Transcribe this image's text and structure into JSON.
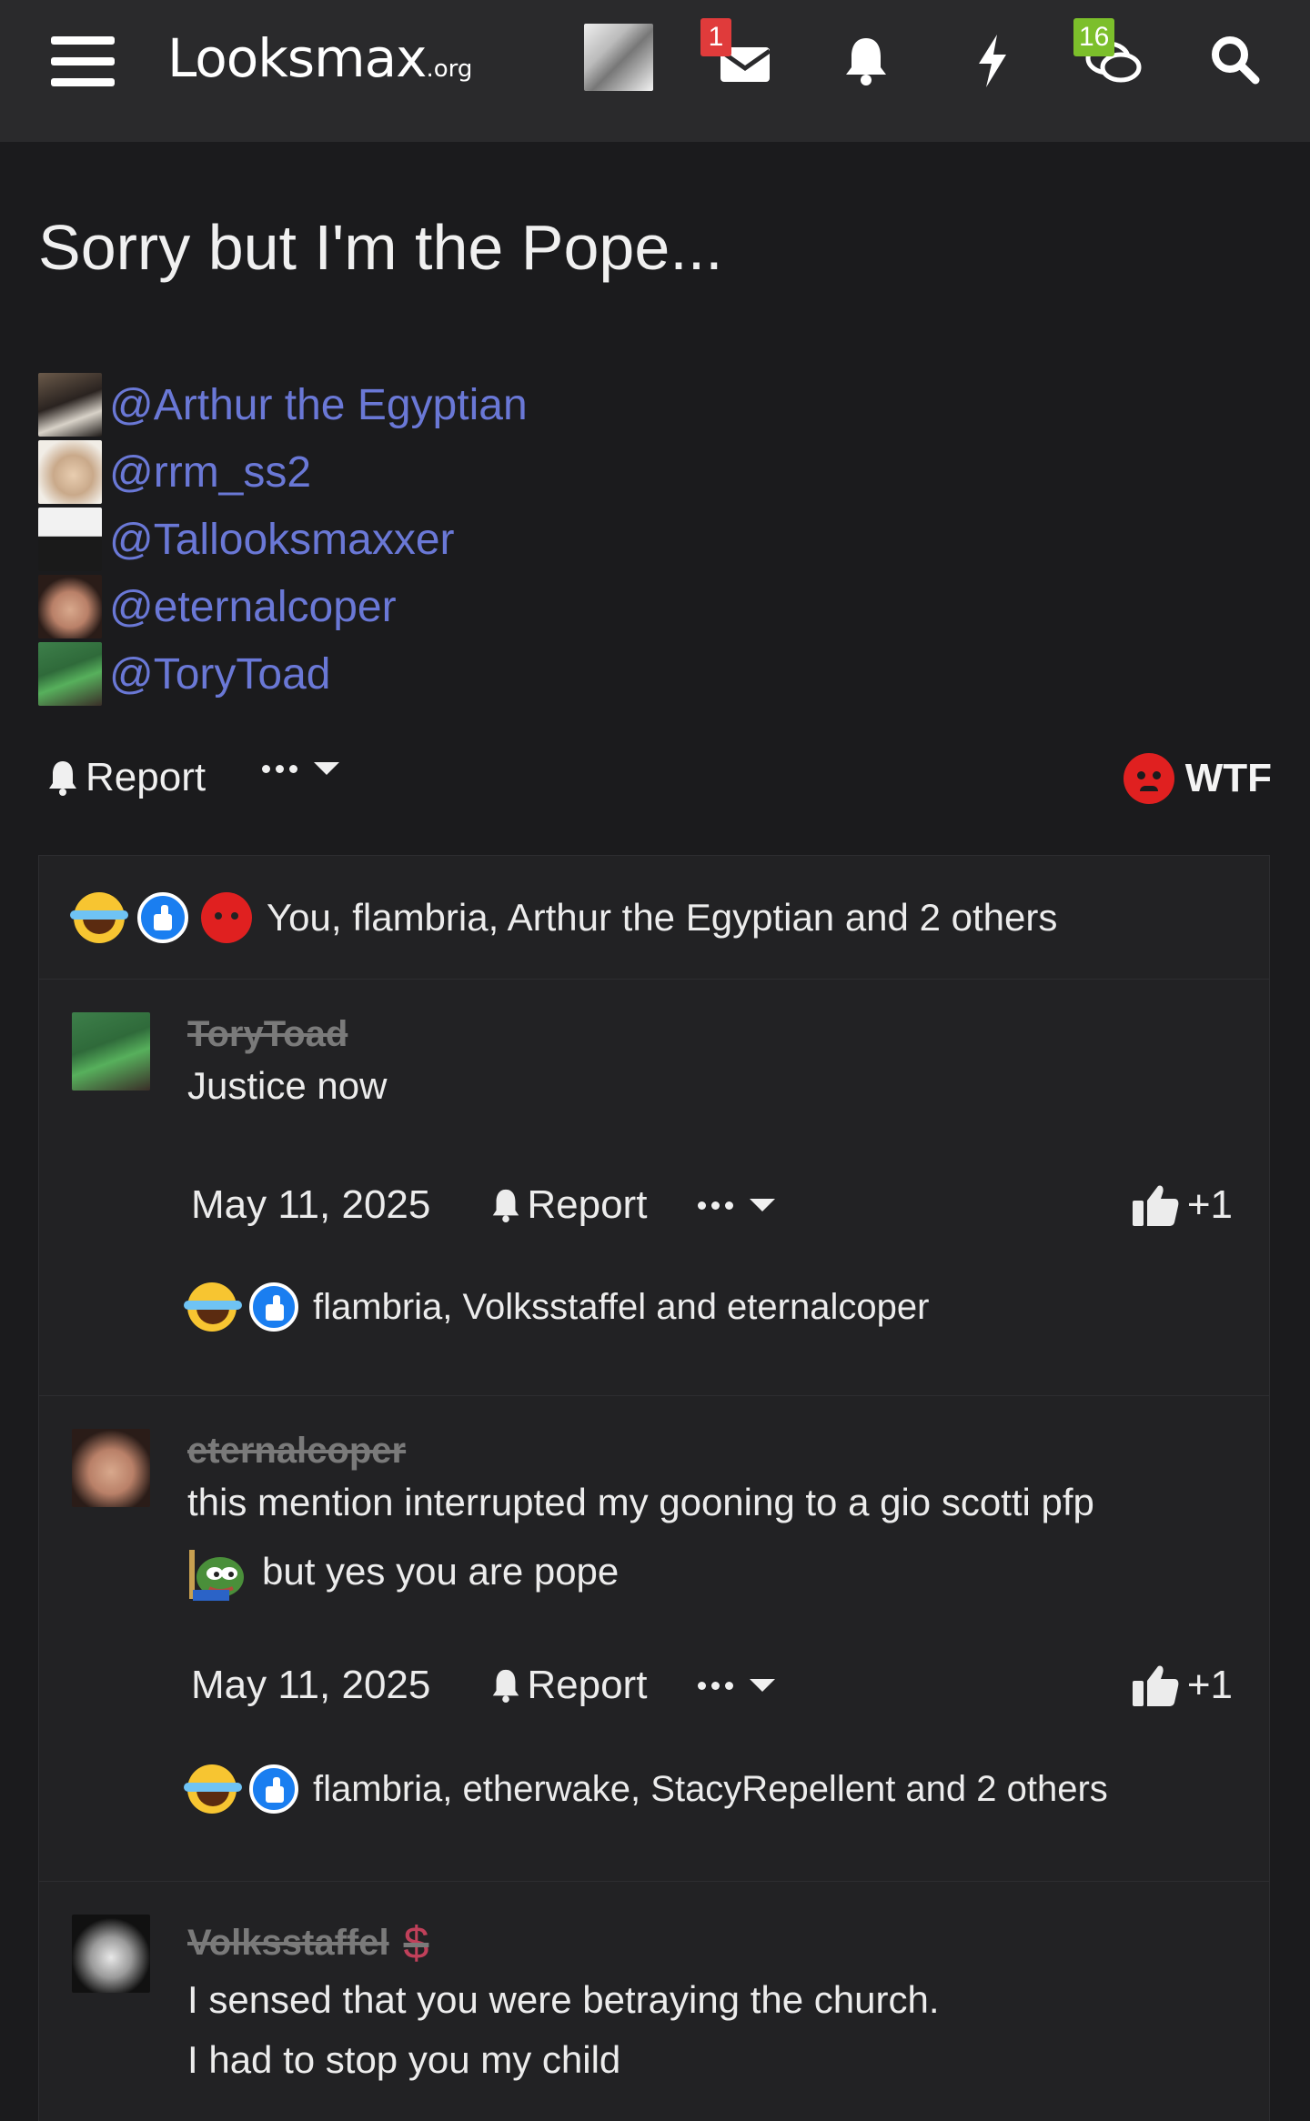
{
  "topbar": {
    "logo_main": "Looksmax",
    "logo_suffix": ".org",
    "inbox_badge": "1",
    "conversations_badge": "16",
    "icons": [
      "menu-icon",
      "avatar",
      "envelope-icon",
      "bell-icon",
      "bolt-icon",
      "chat-bubbles-icon",
      "search-icon"
    ]
  },
  "thread": {
    "title": "Sorry but I'm the Pope...",
    "mentions": [
      {
        "name": "@Arthur the Egyptian"
      },
      {
        "name": "@rrm_ss2"
      },
      {
        "name": "@Tallooksmaxxer"
      },
      {
        "name": "@eternalcoper"
      },
      {
        "name": "@ToryToad"
      }
    ],
    "actions": {
      "report": "Report",
      "reaction_label": "WTF"
    },
    "reactions_summary": "You, flambria, Arthur the Egyptian and 2 others"
  },
  "comments": [
    {
      "user": "ToryToad",
      "text": "Justice now",
      "date": "May 11, 2025",
      "report": "Report",
      "plus": "+1",
      "reactions": "flambria, Volksstaffel and eternalcoper"
    },
    {
      "user": "eternalcoper",
      "text_line1": "this mention interrupted my gooning to a gio scotti pfp",
      "text_line2": "but yes you are pope",
      "date": "May 11, 2025",
      "report": "Report",
      "plus": "+1",
      "reactions": "flambria, etherwake, StacyRepellent and 2 others"
    },
    {
      "user": "Volksstaffel",
      "badge": "$",
      "text_line1": "I sensed that you were betraying the church.",
      "text_line2": "I had to stop you my child"
    }
  ],
  "colors": {
    "background": "#1b1b1d",
    "topbar": "#2a2a2c",
    "mention_link": "#6a78d6",
    "badge_red": "#e03b3b",
    "badge_green": "#7cbf2b"
  }
}
